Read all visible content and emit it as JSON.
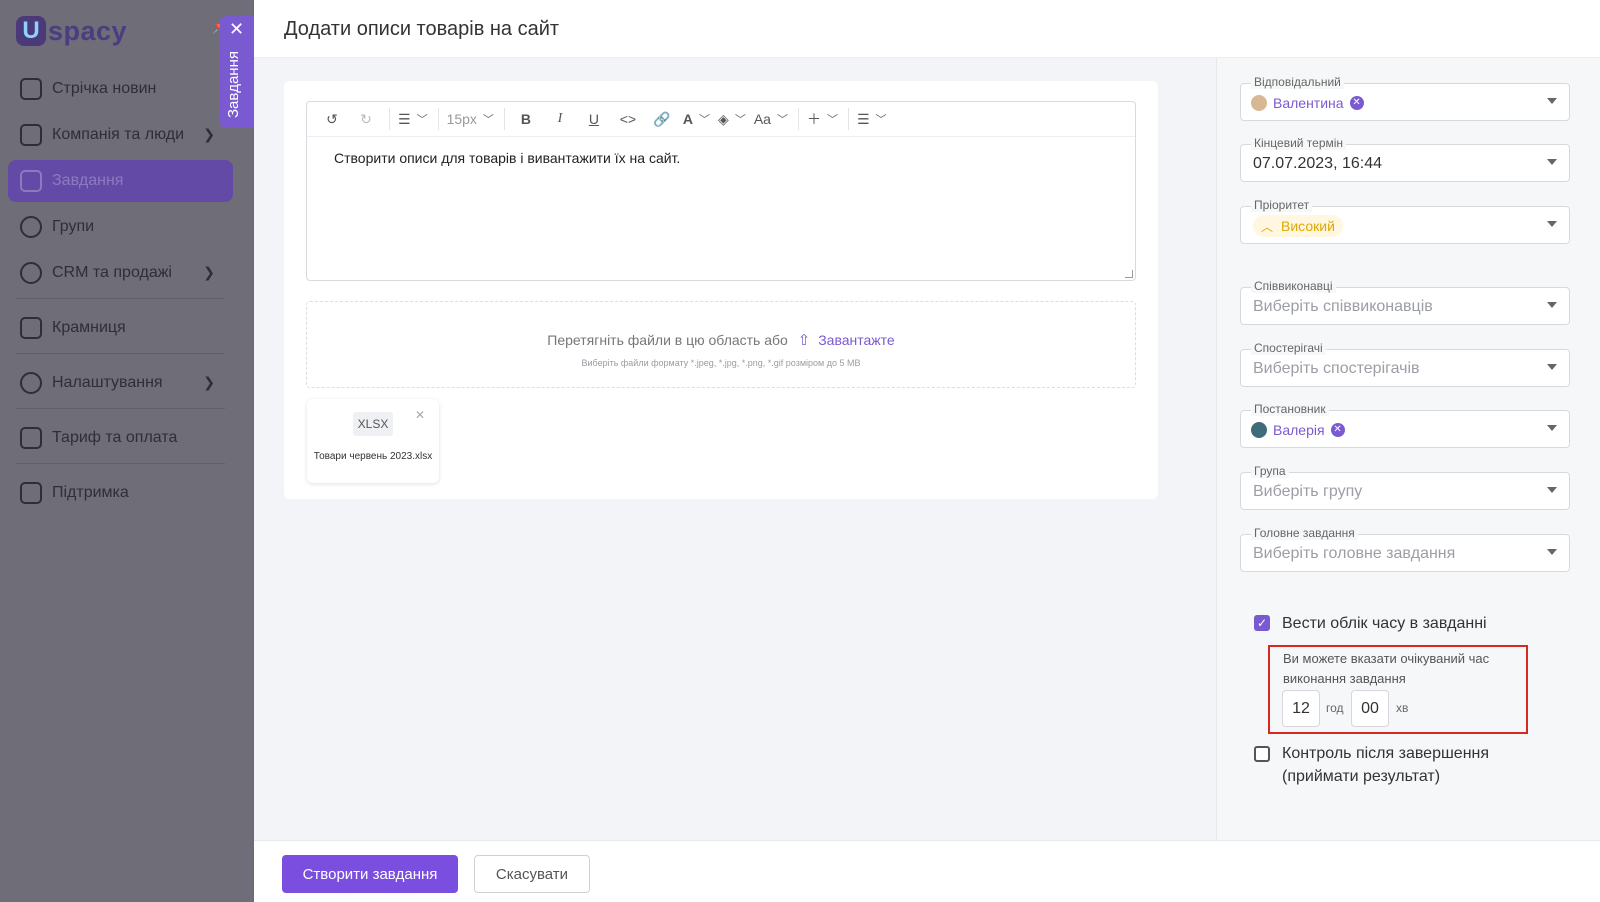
{
  "sidebar": {
    "logo_mark": "U",
    "logo_text": "spacy",
    "items": [
      {
        "label": "Стрічка новин",
        "icon": "home-icon"
      },
      {
        "label": "Компанія та люди",
        "icon": "company-icon"
      },
      {
        "label": "Завдання",
        "icon": "calendar-icon"
      },
      {
        "label": "Групи",
        "icon": "users-icon"
      },
      {
        "label": "CRM та продажі",
        "icon": "database-icon"
      },
      {
        "label": "Крамниця",
        "icon": "store-icon"
      },
      {
        "label": "Налаштування",
        "icon": "gear-icon"
      },
      {
        "label": "Тариф та оплата",
        "icon": "wallet-icon"
      },
      {
        "label": "Підтримка",
        "icon": "help-icon"
      }
    ],
    "vertical_tab": {
      "close": "✕",
      "label": "Завдання"
    }
  },
  "header": {
    "title": "Додати описи товарів на сайт"
  },
  "editor": {
    "font_size": "15px",
    "content": "Створити описи для товарів і вивантажити їх на сайт."
  },
  "dropzone": {
    "text": "Перетягніть файли в цю область або",
    "link": "Завантажте",
    "hint": "Виберіть файли формату *.jpeg, *.jpg, *.png, *.gif розміром до 5 MB"
  },
  "attachment": {
    "type": "XLSX",
    "name": "Товари червень 2023.xlsx"
  },
  "fields": {
    "responsible": {
      "label": "Відповідальний",
      "value": "Валентина"
    },
    "deadline": {
      "label": "Кінцевий термін",
      "value": "07.07.2023, 16:44"
    },
    "priority": {
      "label": "Пріоритет",
      "value": "Високий"
    },
    "coexecutors": {
      "label": "Співвиконавці",
      "placeholder": "Виберіть співвиконавців"
    },
    "observers": {
      "label": "Спостерігачі",
      "placeholder": "Виберіть спостерігачів"
    },
    "author": {
      "label": "Постановник",
      "value": "Валерія"
    },
    "group": {
      "label": "Група",
      "placeholder": "Виберіть групу"
    },
    "parent": {
      "label": "Головне завдання",
      "placeholder": "Виберіть головне завдання"
    }
  },
  "time_tracking": {
    "checkbox_label": "Вести облік часу в завданні",
    "checked": true,
    "hint": "Ви можете вказати очікуваний час виконання завдання",
    "hours": "12",
    "hours_unit": "год",
    "minutes": "00",
    "minutes_unit": "хв"
  },
  "control": {
    "checkbox_label": "Контроль після завершення (приймати результат)",
    "checked": false
  },
  "footer": {
    "create": "Створити завдання",
    "cancel": "Скасувати"
  },
  "colors": {
    "accent": "#7a4fe0",
    "highlight": "#d8281f",
    "priority": "#e0a800"
  }
}
